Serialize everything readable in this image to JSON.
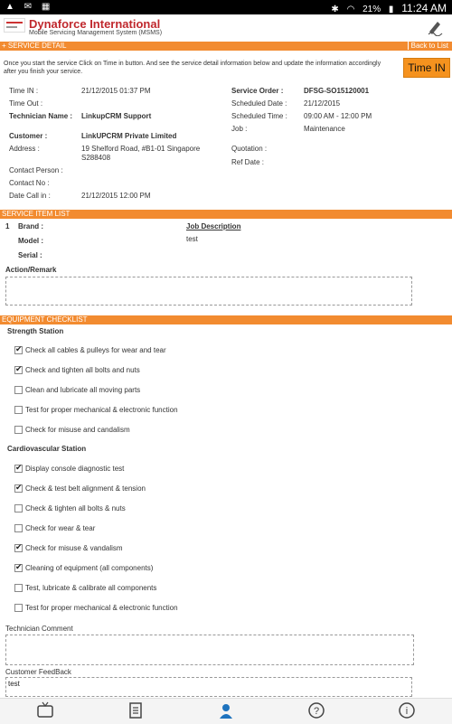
{
  "statusbar": {
    "left_icons": "▲ ✉ ▦",
    "bluetooth": "✱",
    "battery": "21%",
    "time": "11:24 AM"
  },
  "header": {
    "title": "Dynaforce International",
    "subtitle": "Mobile Servicing Management System (MSMS)"
  },
  "service_detail": {
    "section_label": "+ SERVICE DETAIL",
    "back_label": "Back to List",
    "intro": "Once you start the service Click on Time in button. And see the service detail information below and update the information accordingly after you finish your service.",
    "time_in_button": "Time IN",
    "left_fields": [
      {
        "label": "Time IN :",
        "value": "21/12/2015 01:37 PM",
        "bold": false
      },
      {
        "label": "Time Out :",
        "value": "",
        "bold": false
      },
      {
        "label": "Technician Name :",
        "value": "LinkupCRM Support",
        "bold": true
      },
      {
        "label": "Customer :",
        "value": "LinkUPCRM Private Limited",
        "bold": true
      },
      {
        "label": "Address :",
        "value": "19 Shelford Road, #B1-01 Singapore S288408",
        "bold": false
      },
      {
        "label": "Contact Person :",
        "value": "",
        "bold": false
      },
      {
        "label": "Contact No :",
        "value": "",
        "bold": false
      },
      {
        "label": "Date Call in :",
        "value": "21/12/2015 12:00 PM",
        "bold": false
      }
    ],
    "right_fields": [
      {
        "label": "Service Order :",
        "value": "DFSG-SO15120001",
        "bold": true
      },
      {
        "label": "Scheduled Date :",
        "value": "21/12/2015",
        "bold": false
      },
      {
        "label": "Scheduled Time :",
        "value": "09:00 AM - 12:00 PM",
        "bold": false
      },
      {
        "label": "Job :",
        "value": "Maintenance",
        "bold": false
      },
      {
        "label": "Quotation :",
        "value": "",
        "bold": false
      },
      {
        "label": "Ref Date :",
        "value": "",
        "bold": false
      }
    ]
  },
  "service_item": {
    "section_label": "SERVICE ITEM LIST",
    "index": "1",
    "brand_label": "Brand :",
    "model_label": "Model :",
    "serial_label": "Serial :",
    "job_desc_label": "Job Description",
    "job_desc_value": "test",
    "action_label": "Action/Remark",
    "action_value": ""
  },
  "checklist": {
    "section_label": "EQUIPMENT CHECKLIST",
    "groups": [
      {
        "title": "Strength Station",
        "items": [
          {
            "label": "Check all cables & pulleys for wear and tear",
            "checked": true
          },
          {
            "label": "Check and tighten all bolts and nuts",
            "checked": true
          },
          {
            "label": "Clean and lubricate all moving parts",
            "checked": false
          },
          {
            "label": "Test for proper mechanical & electronic function",
            "checked": false
          },
          {
            "label": "Check for misuse and candalism",
            "checked": false
          }
        ]
      },
      {
        "title": "Cardiovascular Station",
        "items": [
          {
            "label": "Display console diagnostic test",
            "checked": true
          },
          {
            "label": "Check & test belt alignment & tension",
            "checked": true
          },
          {
            "label": "Check & tighten all bolts & nuts",
            "checked": false
          },
          {
            "label": "Check for wear & tear",
            "checked": false
          },
          {
            "label": "Check for misuse & vandalism",
            "checked": true
          },
          {
            "label": "Cleaning of equipment (all components)",
            "checked": true
          },
          {
            "label": "Test, lubricate & calibrate all components",
            "checked": false
          },
          {
            "label": "Test for proper mechanical & electronic function",
            "checked": false
          }
        ]
      }
    ]
  },
  "comments": {
    "technician_label": "Technician Comment",
    "technician_value": "",
    "customer_label": "Customer FeedBack",
    "customer_value": "test"
  },
  "bottom_nav": [
    {
      "name": "tv-icon"
    },
    {
      "name": "document-icon"
    },
    {
      "name": "user-icon"
    },
    {
      "name": "help-icon"
    },
    {
      "name": "info-icon"
    }
  ],
  "colors": {
    "accent": "#f28b30",
    "brand_red": "#c0282d",
    "nav_active": "#1e73be"
  }
}
